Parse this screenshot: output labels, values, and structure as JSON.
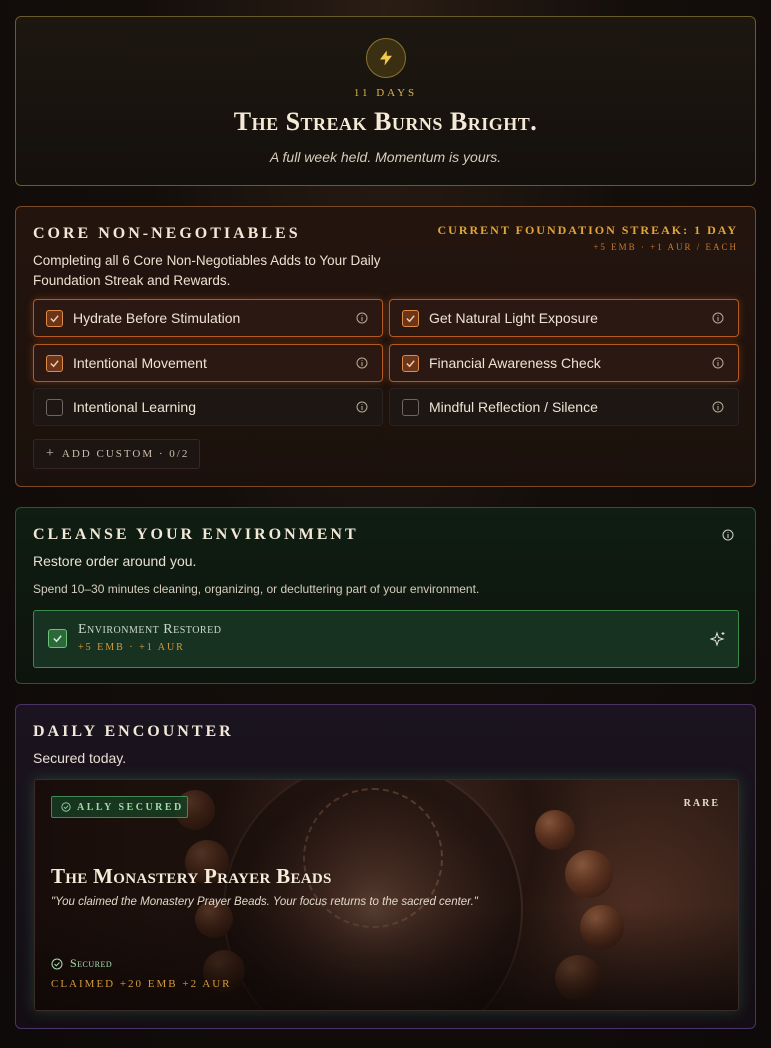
{
  "streak": {
    "days": "11 DAYS",
    "title": "The Streak Burns Bright.",
    "subtitle": "A full week held. Momentum is yours."
  },
  "core": {
    "title": "CORE NON-NEGOTIABLES",
    "description": "Completing all 6 Core Non-Negotiables Adds to Your Daily Foundation Streak and Rewards.",
    "foundation_streak": "CURRENT FOUNDATION STREAK: 1 DAY",
    "reward_each": "+5 EMB · +1 AUR / EACH",
    "tasks": [
      {
        "label": "Hydrate Before Stimulation",
        "checked": true
      },
      {
        "label": "Get Natural Light Exposure",
        "checked": true
      },
      {
        "label": "Intentional Movement",
        "checked": true
      },
      {
        "label": "Financial Awareness Check",
        "checked": true
      },
      {
        "label": "Intentional Learning",
        "checked": false
      },
      {
        "label": "Mindful Reflection / Silence",
        "checked": false
      }
    ],
    "add_custom": "ADD CUSTOM · 0/2"
  },
  "cleanse": {
    "title": "CLEANSE YOUR ENVIRONMENT",
    "subtitle": "Restore order around you.",
    "description": "Spend 10–30 minutes cleaning, organizing, or decluttering part of your environment.",
    "item_title": "Environment Restored",
    "item_reward": "+5 EMB · +1 AUR",
    "checked": true
  },
  "encounter": {
    "title": "DAILY ENCOUNTER",
    "subtitle": "Secured today.",
    "badge": "ALLY SECURED",
    "rarity": "RARE",
    "item_name": "The Monastery Prayer Beads",
    "quote": "\"You claimed the Monastery Prayer Beads. Your focus returns to the sacred center.\"",
    "status": "Secured",
    "claimed": "CLAIMED +20 EMB +2 AUR"
  },
  "colors": {
    "gold": "#d9b64a",
    "ember": "#e08a48",
    "green": "#3e8a48",
    "purple": "#4a3466"
  }
}
